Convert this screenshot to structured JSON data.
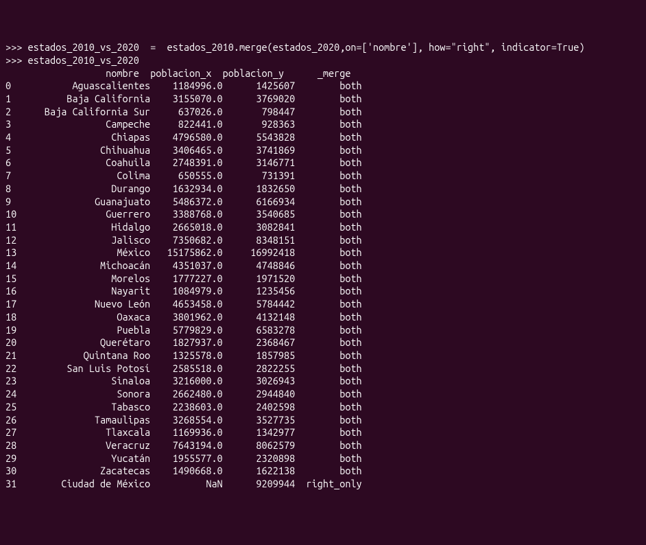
{
  "prompt": ">>> ",
  "cmd1": "estados_2010_vs_2020  =  estados_2010.merge(estados_2020,on=['nombre'], how=\"right\", indicator=True)",
  "cmd2": "estados_2010_vs_2020",
  "header": "                  nombre  poblacion_x  poblacion_y      _merge",
  "rows": [
    {
      "idx": "0 ",
      "nombre": "        Aguascalientes",
      "px": "    1184996.0",
      "py": "      1425607",
      "mg": "        both"
    },
    {
      "idx": "1 ",
      "nombre": "       Baja California",
      "px": "    3155070.0",
      "py": "      3769020",
      "mg": "        both"
    },
    {
      "idx": "2 ",
      "nombre": "   Baja California Sur",
      "px": "     637026.0",
      "py": "       798447",
      "mg": "        both"
    },
    {
      "idx": "3 ",
      "nombre": "              Campeche",
      "px": "     822441.0",
      "py": "       928363",
      "mg": "        both"
    },
    {
      "idx": "4 ",
      "nombre": "               Chiapas",
      "px": "    4796580.0",
      "py": "      5543828",
      "mg": "        both"
    },
    {
      "idx": "5 ",
      "nombre": "             Chihuahua",
      "px": "    3406465.0",
      "py": "      3741869",
      "mg": "        both"
    },
    {
      "idx": "6 ",
      "nombre": "              Coahuila",
      "px": "    2748391.0",
      "py": "      3146771",
      "mg": "        both"
    },
    {
      "idx": "7 ",
      "nombre": "                Colima",
      "px": "     650555.0",
      "py": "       731391",
      "mg": "        both"
    },
    {
      "idx": "8 ",
      "nombre": "               Durango",
      "px": "    1632934.0",
      "py": "      1832650",
      "mg": "        both"
    },
    {
      "idx": "9 ",
      "nombre": "            Guanajuato",
      "px": "    5486372.0",
      "py": "      6166934",
      "mg": "        both"
    },
    {
      "idx": "10",
      "nombre": "              Guerrero",
      "px": "    3388768.0",
      "py": "      3540685",
      "mg": "        both"
    },
    {
      "idx": "11",
      "nombre": "               Hidalgo",
      "px": "    2665018.0",
      "py": "      3082841",
      "mg": "        both"
    },
    {
      "idx": "12",
      "nombre": "               Jalisco",
      "px": "    7350682.0",
      "py": "      8348151",
      "mg": "        both"
    },
    {
      "idx": "13",
      "nombre": "                México",
      "px": "   15175862.0",
      "py": "     16992418",
      "mg": "        both"
    },
    {
      "idx": "14",
      "nombre": "             Michoacán",
      "px": "    4351037.0",
      "py": "      4748846",
      "mg": "        both"
    },
    {
      "idx": "15",
      "nombre": "               Morelos",
      "px": "    1777227.0",
      "py": "      1971520",
      "mg": "        both"
    },
    {
      "idx": "16",
      "nombre": "               Nayarit",
      "px": "    1084979.0",
      "py": "      1235456",
      "mg": "        both"
    },
    {
      "idx": "17",
      "nombre": "            Nuevo León",
      "px": "    4653458.0",
      "py": "      5784442",
      "mg": "        both"
    },
    {
      "idx": "18",
      "nombre": "                Oaxaca",
      "px": "    3801962.0",
      "py": "      4132148",
      "mg": "        both"
    },
    {
      "idx": "19",
      "nombre": "                Puebla",
      "px": "    5779829.0",
      "py": "      6583278",
      "mg": "        both"
    },
    {
      "idx": "20",
      "nombre": "             Querétaro",
      "px": "    1827937.0",
      "py": "      2368467",
      "mg": "        both"
    },
    {
      "idx": "21",
      "nombre": "          Quintana Roo",
      "px": "    1325578.0",
      "py": "      1857985",
      "mg": "        both"
    },
    {
      "idx": "22",
      "nombre": "       San Luis Potosí",
      "px": "    2585518.0",
      "py": "      2822255",
      "mg": "        both"
    },
    {
      "idx": "23",
      "nombre": "               Sinaloa",
      "px": "    3216000.0",
      "py": "      3026943",
      "mg": "        both"
    },
    {
      "idx": "24",
      "nombre": "                Sonora",
      "px": "    2662480.0",
      "py": "      2944840",
      "mg": "        both"
    },
    {
      "idx": "25",
      "nombre": "               Tabasco",
      "px": "    2238603.0",
      "py": "      2402598",
      "mg": "        both"
    },
    {
      "idx": "26",
      "nombre": "            Tamaulipas",
      "px": "    3268554.0",
      "py": "      3527735",
      "mg": "        both"
    },
    {
      "idx": "27",
      "nombre": "              Tlaxcala",
      "px": "    1169936.0",
      "py": "      1342977",
      "mg": "        both"
    },
    {
      "idx": "28",
      "nombre": "              Veracruz",
      "px": "    7643194.0",
      "py": "      8062579",
      "mg": "        both"
    },
    {
      "idx": "29",
      "nombre": "               Yucatán",
      "px": "    1955577.0",
      "py": "      2320898",
      "mg": "        both"
    },
    {
      "idx": "30",
      "nombre": "             Zacatecas",
      "px": "    1490668.0",
      "py": "      1622138",
      "mg": "        both"
    },
    {
      "idx": "31",
      "nombre": "      Ciudad de México",
      "px": "          NaN",
      "py": "      9209944",
      "mg": "  right_only"
    }
  ],
  "chart_data": {
    "type": "table",
    "title": "estados_2010_vs_2020",
    "columns": [
      "nombre",
      "poblacion_x",
      "poblacion_y",
      "_merge"
    ],
    "rows": [
      [
        "Aguascalientes",
        1184996.0,
        1425607,
        "both"
      ],
      [
        "Baja California",
        3155070.0,
        3769020,
        "both"
      ],
      [
        "Baja California Sur",
        637026.0,
        798447,
        "both"
      ],
      [
        "Campeche",
        822441.0,
        928363,
        "both"
      ],
      [
        "Chiapas",
        4796580.0,
        5543828,
        "both"
      ],
      [
        "Chihuahua",
        3406465.0,
        3741869,
        "both"
      ],
      [
        "Coahuila",
        2748391.0,
        3146771,
        "both"
      ],
      [
        "Colima",
        650555.0,
        731391,
        "both"
      ],
      [
        "Durango",
        1632934.0,
        1832650,
        "both"
      ],
      [
        "Guanajuato",
        5486372.0,
        6166934,
        "both"
      ],
      [
        "Guerrero",
        3388768.0,
        3540685,
        "both"
      ],
      [
        "Hidalgo",
        2665018.0,
        3082841,
        "both"
      ],
      [
        "Jalisco",
        7350682.0,
        8348151,
        "both"
      ],
      [
        "México",
        15175862.0,
        16992418,
        "both"
      ],
      [
        "Michoacán",
        4351037.0,
        4748846,
        "both"
      ],
      [
        "Morelos",
        1777227.0,
        1971520,
        "both"
      ],
      [
        "Nayarit",
        1084979.0,
        1235456,
        "both"
      ],
      [
        "Nuevo León",
        4653458.0,
        5784442,
        "both"
      ],
      [
        "Oaxaca",
        3801962.0,
        4132148,
        "both"
      ],
      [
        "Puebla",
        5779829.0,
        6583278,
        "both"
      ],
      [
        "Querétaro",
        1827937.0,
        2368467,
        "both"
      ],
      [
        "Quintana Roo",
        1325578.0,
        1857985,
        "both"
      ],
      [
        "San Luis Potosí",
        2585518.0,
        2822255,
        "both"
      ],
      [
        "Sinaloa",
        3216000.0,
        3026943,
        "both"
      ],
      [
        "Sonora",
        2662480.0,
        2944840,
        "both"
      ],
      [
        "Tabasco",
        2238603.0,
        2402598,
        "both"
      ],
      [
        "Tamaulipas",
        3268554.0,
        3527735,
        "both"
      ],
      [
        "Tlaxcala",
        1169936.0,
        1342977,
        "both"
      ],
      [
        "Veracruz",
        7643194.0,
        8062579,
        "both"
      ],
      [
        "Yucatán",
        1955577.0,
        2320898,
        "both"
      ],
      [
        "Zacatecas",
        1490668.0,
        1622138,
        "both"
      ],
      [
        "Ciudad de México",
        null,
        9209944,
        "right_only"
      ]
    ]
  }
}
